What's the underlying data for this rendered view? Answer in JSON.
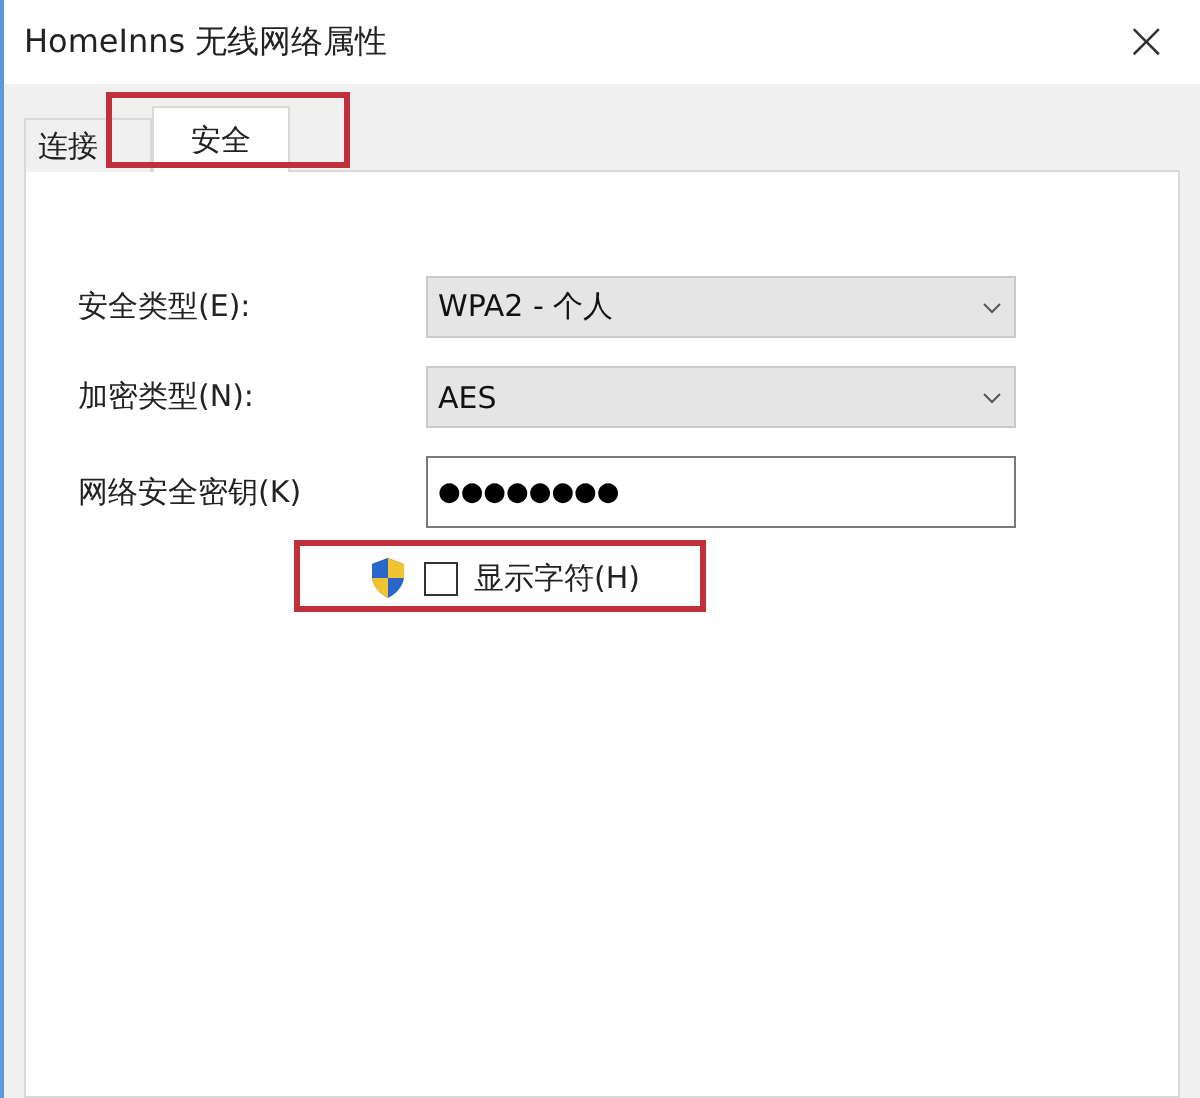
{
  "window": {
    "title": "HomeInns 无线网络属性",
    "close": "×"
  },
  "tabs": [
    {
      "label": "连接",
      "selected": false,
      "highlighted": false
    },
    {
      "label": "安全",
      "selected": true,
      "highlighted": true
    }
  ],
  "fields": [
    {
      "kind": "combo",
      "label": "安全类型(E):",
      "value": "WPA2 - 个人"
    },
    {
      "kind": "combo",
      "label": "加密类型(N):",
      "value": "AES"
    },
    {
      "kind": "password",
      "label": "网络安全密钥(K)",
      "value": "●●●●●●●●"
    }
  ],
  "show_characters": {
    "label": "显示字符(H)",
    "checked": false,
    "highlighted": true
  }
}
